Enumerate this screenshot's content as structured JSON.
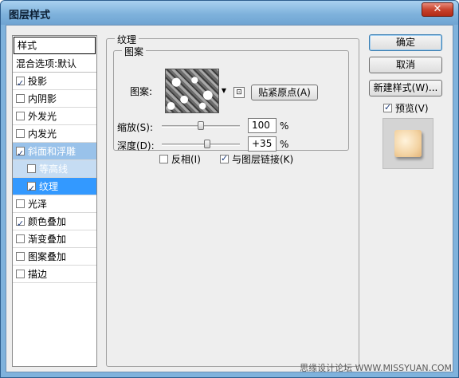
{
  "window": {
    "title": "图层样式",
    "close_glyph": "✕"
  },
  "style_list": {
    "header": "样式",
    "blend_options": "混合选项:默认",
    "items": [
      {
        "label": "投影",
        "checked": true
      },
      {
        "label": "内阴影",
        "checked": false
      },
      {
        "label": "外发光",
        "checked": false
      },
      {
        "label": "内发光",
        "checked": false
      },
      {
        "label": "斜面和浮雕",
        "checked": true
      },
      {
        "label": "等高线",
        "checked": false
      },
      {
        "label": "纹理",
        "checked": true
      },
      {
        "label": "光泽",
        "checked": false
      },
      {
        "label": "颜色叠加",
        "checked": true
      },
      {
        "label": "渐变叠加",
        "checked": false
      },
      {
        "label": "图案叠加",
        "checked": false
      },
      {
        "label": "描边",
        "checked": false
      }
    ]
  },
  "texture": {
    "section_title": "纹理",
    "group_title": "图案",
    "pattern_label": "图案:",
    "snap_button": "贴紧原点(A)",
    "scale_label": "缩放(S):",
    "scale_value": "100",
    "scale_percent": 100,
    "depth_label": "深度(D):",
    "depth_value": "+35",
    "percent_sign": "%",
    "invert_label": "反相(I)",
    "invert_checked": false,
    "link_label": "与图层链接(K)",
    "link_checked": true
  },
  "buttons": {
    "ok": "确定",
    "cancel": "取消",
    "new_style": "新建样式(W)...",
    "preview_label": "预览(V)",
    "preview_checked": true
  },
  "watermark": "思缘设计论坛 WWW.MISSYUAN.COM"
}
